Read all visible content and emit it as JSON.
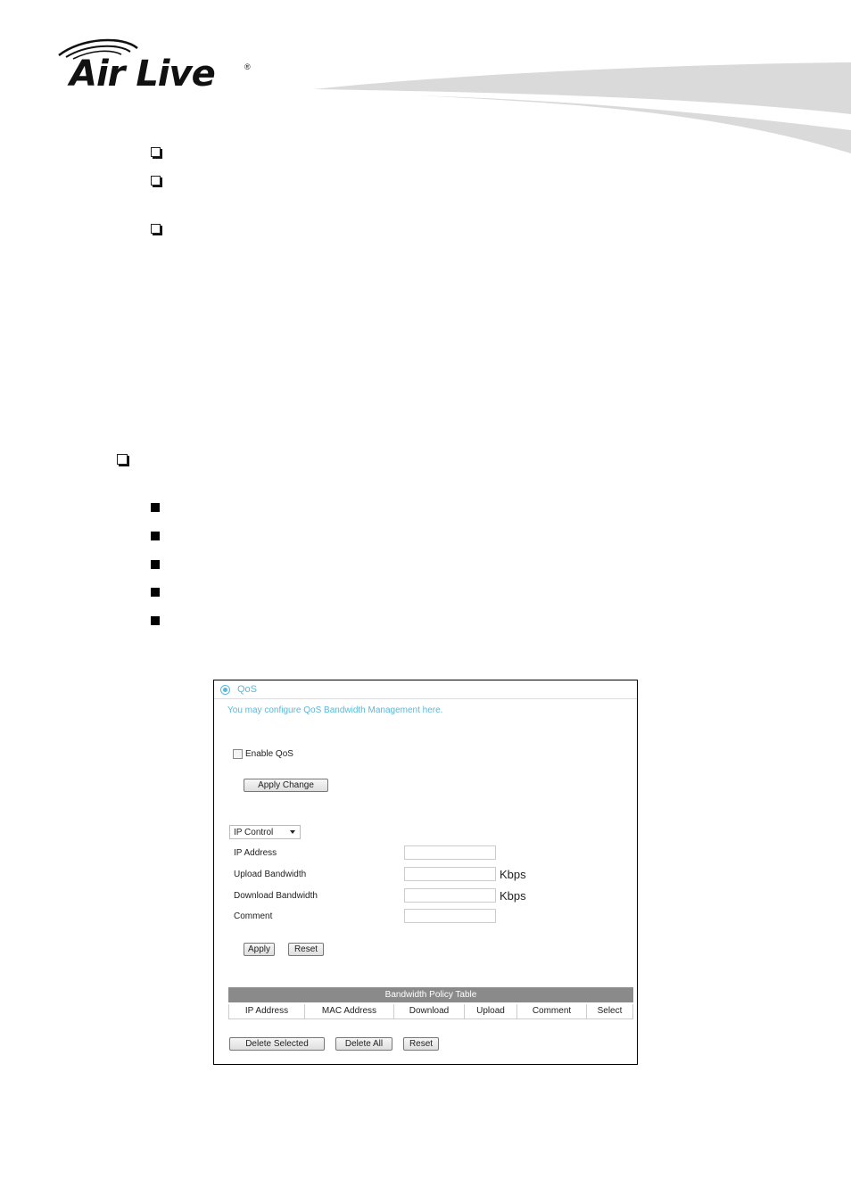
{
  "header": {
    "logo_text": "Air Live",
    "logo_registered": "®"
  },
  "document": {
    "top_bullets": [
      "",
      "",
      ""
    ],
    "section_bullet": "",
    "sub_bullets": [
      "",
      "",
      "",
      "",
      ""
    ]
  },
  "qos_panel": {
    "title": "QoS",
    "description": "You may configure QoS Bandwidth Management here.",
    "enable_label": "Enable QoS",
    "enable_checked": false,
    "apply_change_label": "Apply Change",
    "control_select": {
      "selected": "IP Control"
    },
    "fields": [
      {
        "label": "IP Address",
        "value": "",
        "unit": ""
      },
      {
        "label": "Upload Bandwidth",
        "value": "",
        "unit": "Kbps"
      },
      {
        "label": "Download Bandwidth",
        "value": "",
        "unit": "Kbps"
      },
      {
        "label": "Comment",
        "value": "",
        "unit": ""
      }
    ],
    "apply_label": "Apply",
    "reset_label": "Reset",
    "table": {
      "title": "Bandwidth Policy Table",
      "columns": [
        "IP Address",
        "MAC Address",
        "Download",
        "Upload",
        "Comment",
        "Select"
      ],
      "rows": []
    },
    "delete_selected_label": "Delete Selected",
    "delete_all_label": "Delete All",
    "table_reset_label": "Reset"
  }
}
